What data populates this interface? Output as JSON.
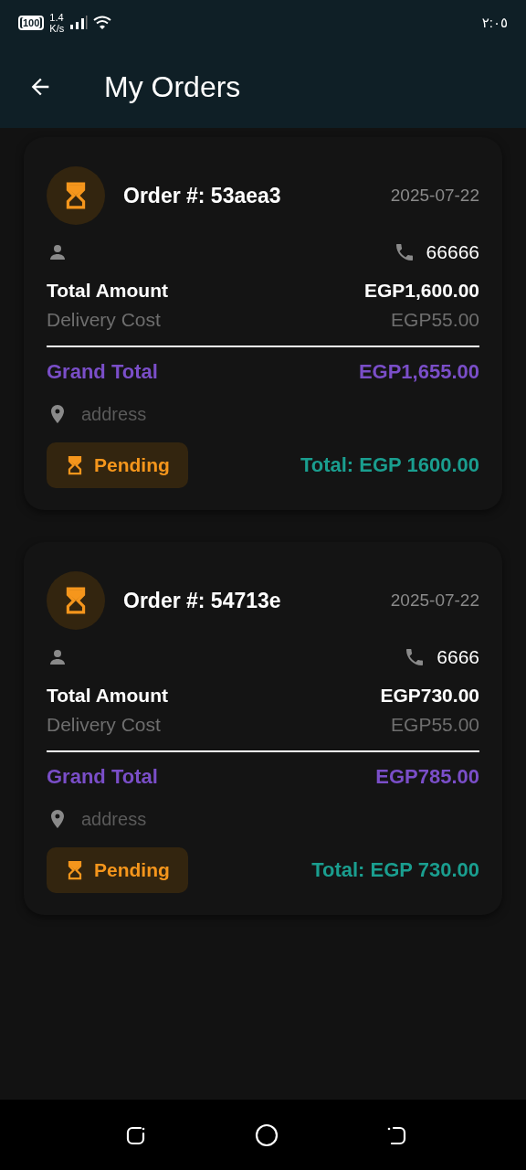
{
  "status_bar": {
    "battery": "100",
    "speed": "1.4",
    "speed_unit": "K/s",
    "time": "٢:٠٥"
  },
  "app_bar": {
    "title": "My Orders"
  },
  "orders": [
    {
      "order_label": "Order #: 53aea3",
      "date": "2025-07-22",
      "phone": "66666",
      "total_label": "Total Amount",
      "total_value": "EGP1,600.00",
      "delivery_label": "Delivery Cost",
      "delivery_value": "EGP55.00",
      "grand_label": "Grand Total",
      "grand_value": "EGP1,655.00",
      "address": "address",
      "status": {
        "kind": "pending",
        "label": "Pending"
      },
      "summary": "Total: EGP 1600.00"
    },
    {
      "order_label": "Order #: 54713e",
      "date": "2025-07-22",
      "phone": "6666",
      "total_label": "Total Amount",
      "total_value": "EGP730.00",
      "delivery_label": "Delivery Cost",
      "delivery_value": "EGP55.00",
      "grand_label": "Grand Total",
      "grand_value": "EGP785.00",
      "address": "address",
      "status": {
        "kind": "pending",
        "label": "Pending"
      },
      "summary": "Total: EGP 730.00"
    }
  ]
}
